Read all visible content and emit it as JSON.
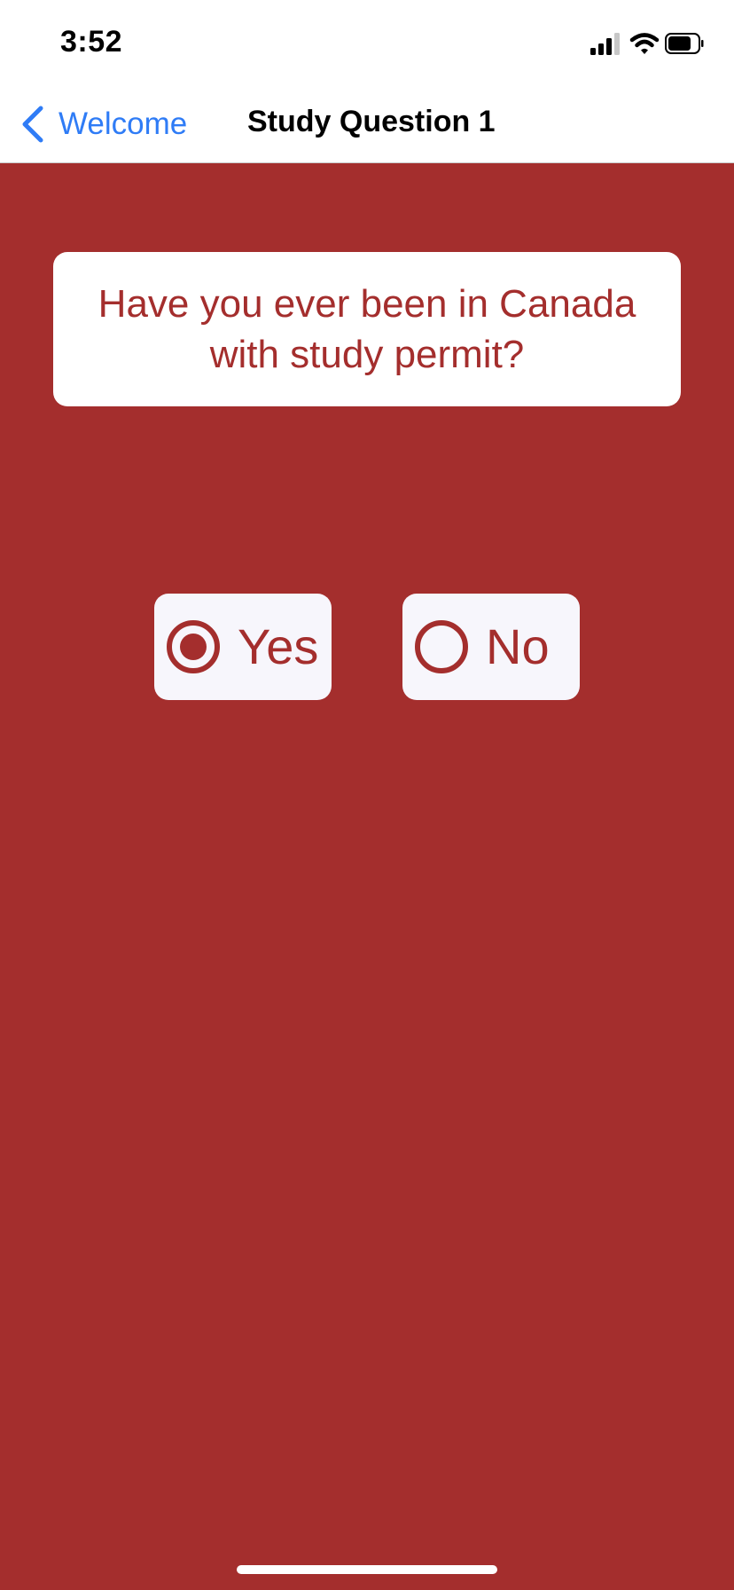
{
  "status_bar": {
    "time": "3:52",
    "icons": [
      "cellular-signal-icon",
      "wifi-icon",
      "battery-icon"
    ]
  },
  "nav": {
    "back_label": "Welcome",
    "title": "Study Question 1"
  },
  "question": {
    "text": "Have you ever been in Canada with study permit?"
  },
  "choices": [
    {
      "label": "Yes",
      "selected": true
    },
    {
      "label": "No",
      "selected": false
    }
  ],
  "colors": {
    "accent_red": "#a42e2d",
    "link_blue": "#2f7cf6",
    "card_white": "#ffffff",
    "button_bg": "#f7f6fc"
  }
}
